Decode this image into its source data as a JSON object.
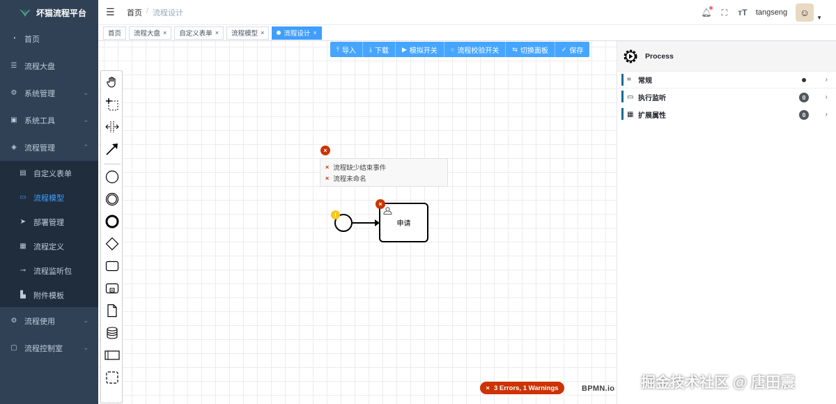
{
  "app": {
    "title": "坏猫流程平台"
  },
  "sidebar": {
    "items": [
      {
        "label": "首页",
        "icon": "dashboard-icon"
      },
      {
        "label": "流程大盘",
        "icon": "list-icon"
      },
      {
        "label": "系统管理",
        "icon": "gear-icon"
      },
      {
        "label": "系统工具",
        "icon": "toolbox-icon"
      },
      {
        "label": "流程管理",
        "icon": "flow-icon"
      }
    ],
    "submenu": [
      {
        "label": "自定义表单",
        "icon": "form-icon"
      },
      {
        "label": "流程模型",
        "icon": "model-icon",
        "active": true
      },
      {
        "label": "部署管理",
        "icon": "send-icon"
      },
      {
        "label": "流程定义",
        "icon": "definition-icon"
      },
      {
        "label": "流程监听包",
        "icon": "toggle-icon"
      },
      {
        "label": "附件模板",
        "icon": "attachment-icon"
      }
    ],
    "bottom": [
      {
        "label": "流程使用",
        "icon": "gear-icon"
      },
      {
        "label": "流程控制室",
        "icon": "monitor-icon"
      }
    ]
  },
  "header": {
    "breadcrumb": [
      "首页",
      "/",
      "流程设计"
    ],
    "username": "tangseng"
  },
  "tags": [
    {
      "label": "首页"
    },
    {
      "label": "流程大盘",
      "close": "×"
    },
    {
      "label": "自定义表单",
      "close": "×"
    },
    {
      "label": "流程模型",
      "close": "×"
    },
    {
      "label": "流程设计",
      "close": "×",
      "active": true
    }
  ],
  "toolbar": {
    "buttons": [
      {
        "label": "导入",
        "icon": "⤒"
      },
      {
        "label": "下载",
        "icon": "⤓"
      },
      {
        "label": "模拟开关",
        "icon": "▶"
      },
      {
        "label": "流程校验开关",
        "icon": "○"
      },
      {
        "label": "切换面板",
        "icon": "⇆"
      },
      {
        "label": "保存",
        "icon": "✓"
      }
    ]
  },
  "validation": {
    "errors": [
      "流程缺少结束事件",
      "流程未命名"
    ],
    "summary": "3 Errors, 1 Warnings",
    "error_mark": "×",
    "warn_mark": "!"
  },
  "diagram": {
    "task_label": "申请"
  },
  "brand": {
    "bpmn": "BPMN.io"
  },
  "watermark": "掘金技术社区 @ 唐田震",
  "panel": {
    "title": "Process",
    "groups": [
      {
        "label": "常规",
        "icon": "general-icon",
        "indicator": "dot"
      },
      {
        "label": "执行监听",
        "icon": "listener-icon",
        "count": "0"
      },
      {
        "label": "扩展属性",
        "icon": "grid-icon",
        "count": "0"
      }
    ]
  }
}
